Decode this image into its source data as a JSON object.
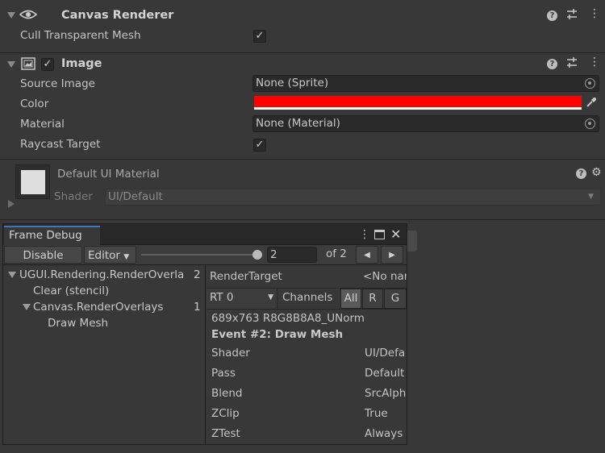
{
  "canvas_renderer": {
    "title": "Canvas Renderer",
    "cull_label": "Cull Transparent Mesh",
    "cull_checked": true
  },
  "image": {
    "title": "Image",
    "enabled": true,
    "source_image_label": "Source Image",
    "source_image_value": "None (Sprite)",
    "color_label": "Color",
    "color_value": "#ff0000",
    "material_label": "Material",
    "material_value": "None (Material)",
    "raycast_label": "Raycast Target",
    "raycast_checked": true
  },
  "material_preview": {
    "name": "Default UI Material",
    "shader_label": "Shader",
    "shader_value": "UI/Default"
  },
  "frame_debug": {
    "tab_title": "Frame Debug",
    "disable_label": "Disable",
    "editor_label": "Editor",
    "slider_fraction": 1.0,
    "event_value": "2",
    "of_total": "of 2",
    "tree": [
      {
        "label": "UGUI.Rendering.RenderOverla",
        "count": "2"
      },
      {
        "label": "Clear (stencil)",
        "count": ""
      },
      {
        "label": "Canvas.RenderOverlays",
        "count": "1"
      },
      {
        "label": "Draw Mesh",
        "count": ""
      }
    ],
    "render_target_label": "RenderTarget",
    "render_target_value": "<No nam",
    "rt_select": "RT 0",
    "channels_label": "Channels",
    "channel_buttons": [
      "All",
      "R",
      "G"
    ],
    "format": "689x763 R8G8B8A8_UNorm",
    "event_title": "Event #2: Draw Mesh",
    "props": [
      {
        "k": "Shader",
        "v": "UI/Defa"
      },
      {
        "k": "Pass",
        "v": "Default"
      },
      {
        "k": "Blend",
        "v": "SrcAlph"
      },
      {
        "k": "ZClip",
        "v": "True"
      },
      {
        "k": "ZTest",
        "v": "Always"
      }
    ]
  }
}
